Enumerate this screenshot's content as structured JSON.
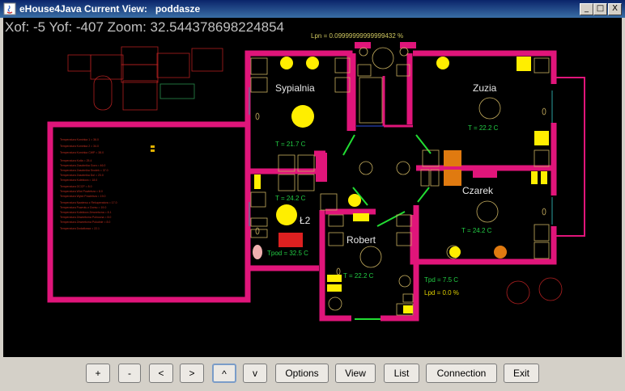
{
  "window": {
    "title": "eHouse4Java Current View:   poddasze",
    "controls": [
      "_",
      "□",
      "X"
    ]
  },
  "view": {
    "coordinates": "Xof: -5 Yof: -407 Zoom: 32.544378698224854",
    "lpn": "Lpn = 0.09999999999999432 %",
    "rooms": {
      "sypialnia": "Sypialnia",
      "zuzia": "Zuzia",
      "czarek": "Czarek",
      "l2": "Ł2",
      "robert": "Robert"
    },
    "temps": {
      "sypialnia": "T = 21.7 C",
      "zuzia": "T = 22.2 C",
      "l2": "T = 24.2 C",
      "czarek": "T = 24.2 C",
      "robert": "T = 22.2 C",
      "tpod": "Tpod = 32.5 C",
      "tpd": "Tpd = 7.5 C"
    },
    "lpd": "Lpd = 0.0 %"
  },
  "colors": {
    "wall": "#e0157a",
    "light": "#ffee00",
    "label_green": "#22cc44",
    "outline": "#c8b060"
  },
  "toolbar": {
    "zoom_in": "+",
    "zoom_out": "-",
    "left": "<",
    "right": ">",
    "up": "^",
    "down": "v",
    "options": "Options",
    "view": "View",
    "list": "List",
    "connection": "Connection",
    "exit": "Exit"
  }
}
